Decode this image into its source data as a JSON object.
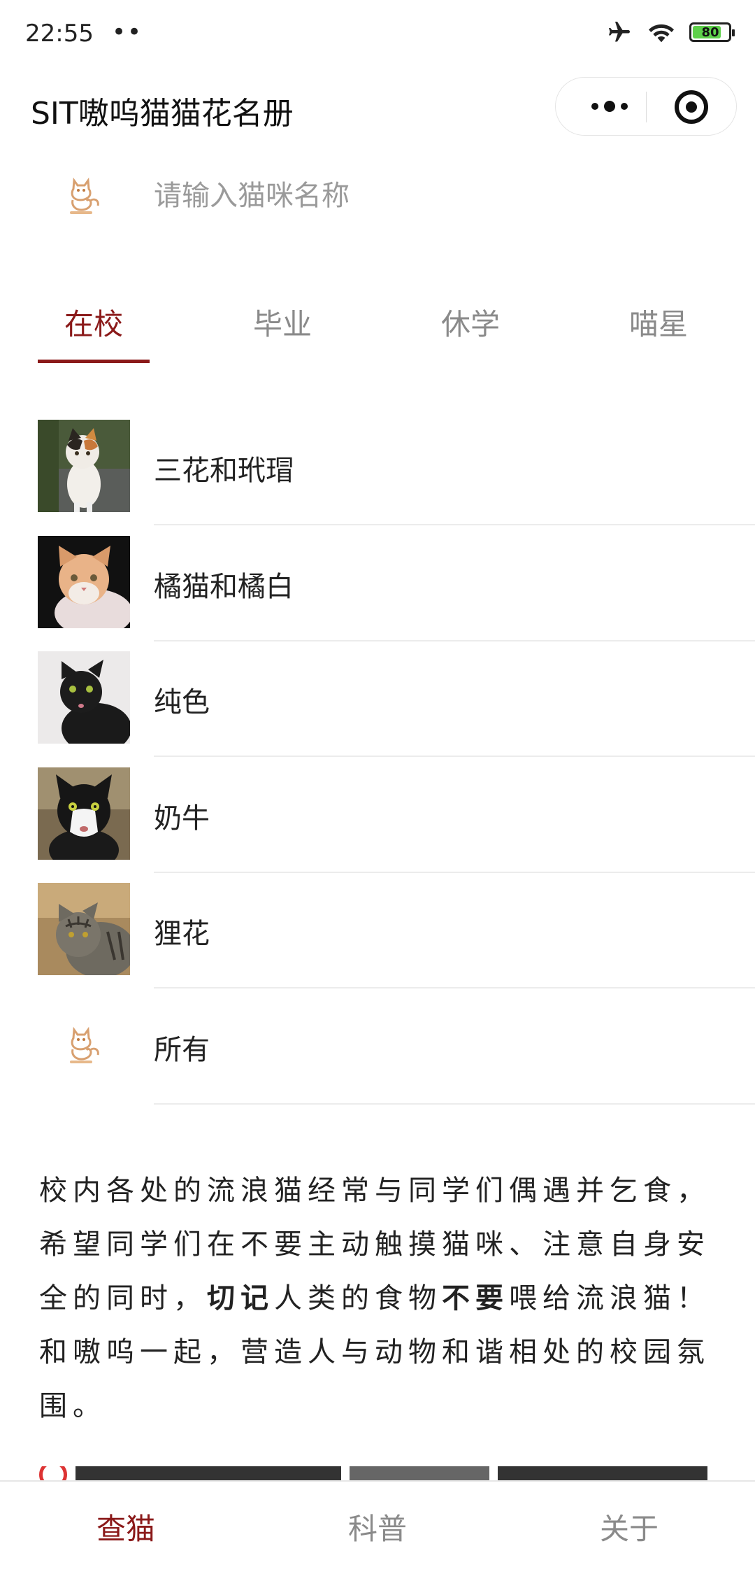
{
  "status_bar": {
    "time": "22:55",
    "dots": "••",
    "battery_level": 80,
    "battery_text": "80"
  },
  "nav_bar": {
    "title": "SIT嗷呜猫猫花名册"
  },
  "search": {
    "placeholder": "请输入猫咪名称"
  },
  "tabs": [
    {
      "label": "在校",
      "active": true
    },
    {
      "label": "毕业",
      "active": false
    },
    {
      "label": "休学",
      "active": false
    },
    {
      "label": "喵星",
      "active": false
    }
  ],
  "cat_list": [
    {
      "label": "三花和玳瑁",
      "photo": "calico-cat-photo"
    },
    {
      "label": "橘猫和橘白",
      "photo": "orange-cat-photo"
    },
    {
      "label": "纯色",
      "photo": "black-cat-photo"
    },
    {
      "label": "奶牛",
      "photo": "tuxedo-cat-photo"
    },
    {
      "label": "狸花",
      "photo": "tabby-cat-photo"
    },
    {
      "label": "所有",
      "photo": "cat-logo-icon"
    }
  ],
  "description": {
    "part1": "校内各处的流浪猫经常与同学们偶遇并乞食，希望同学们在不要主动触摸猫咪、注意自身安全的同时，",
    "bold1": "切记",
    "part2": "人类的食物",
    "bold2": "不要",
    "part3": "喂给流浪猫！和嗷呜一起，营造人与动物和谐相处的校园氛围。"
  },
  "bottom_tabs": [
    {
      "label": "查猫",
      "active": true
    },
    {
      "label": "科普",
      "active": false
    },
    {
      "label": "关于",
      "active": false
    }
  ],
  "colors": {
    "accent": "#8b1a1a",
    "inactive": "#8a8a8a",
    "battery_green": "#5ed04a"
  }
}
